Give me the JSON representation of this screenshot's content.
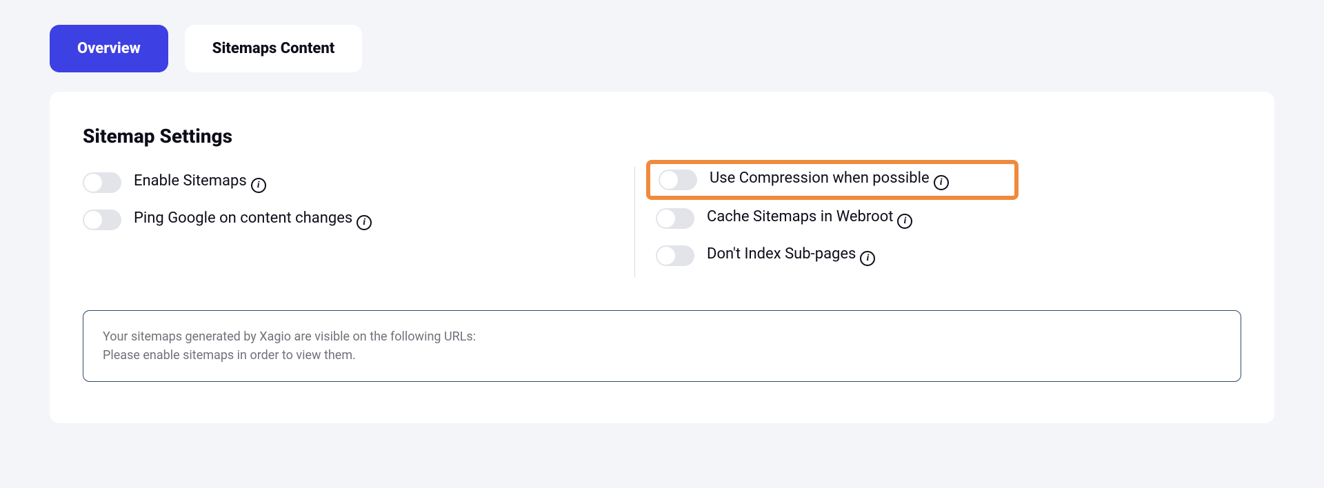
{
  "tabs": {
    "overview": "Overview",
    "sitemaps_content": "Sitemaps Content"
  },
  "page": {
    "title": "Sitemap Settings"
  },
  "settings": {
    "enable_sitemaps": "Enable Sitemaps",
    "ping_google": "Ping Google on content changes",
    "use_compression": "Use Compression when possible",
    "cache_sitemaps": "Cache Sitemaps in Webroot",
    "dont_index_subpages": "Don't Index Sub-pages"
  },
  "notice": {
    "line1": "Your sitemaps generated by Xagio are visible on the following URLs:",
    "line2": "Please enable sitemaps in order to view them."
  }
}
